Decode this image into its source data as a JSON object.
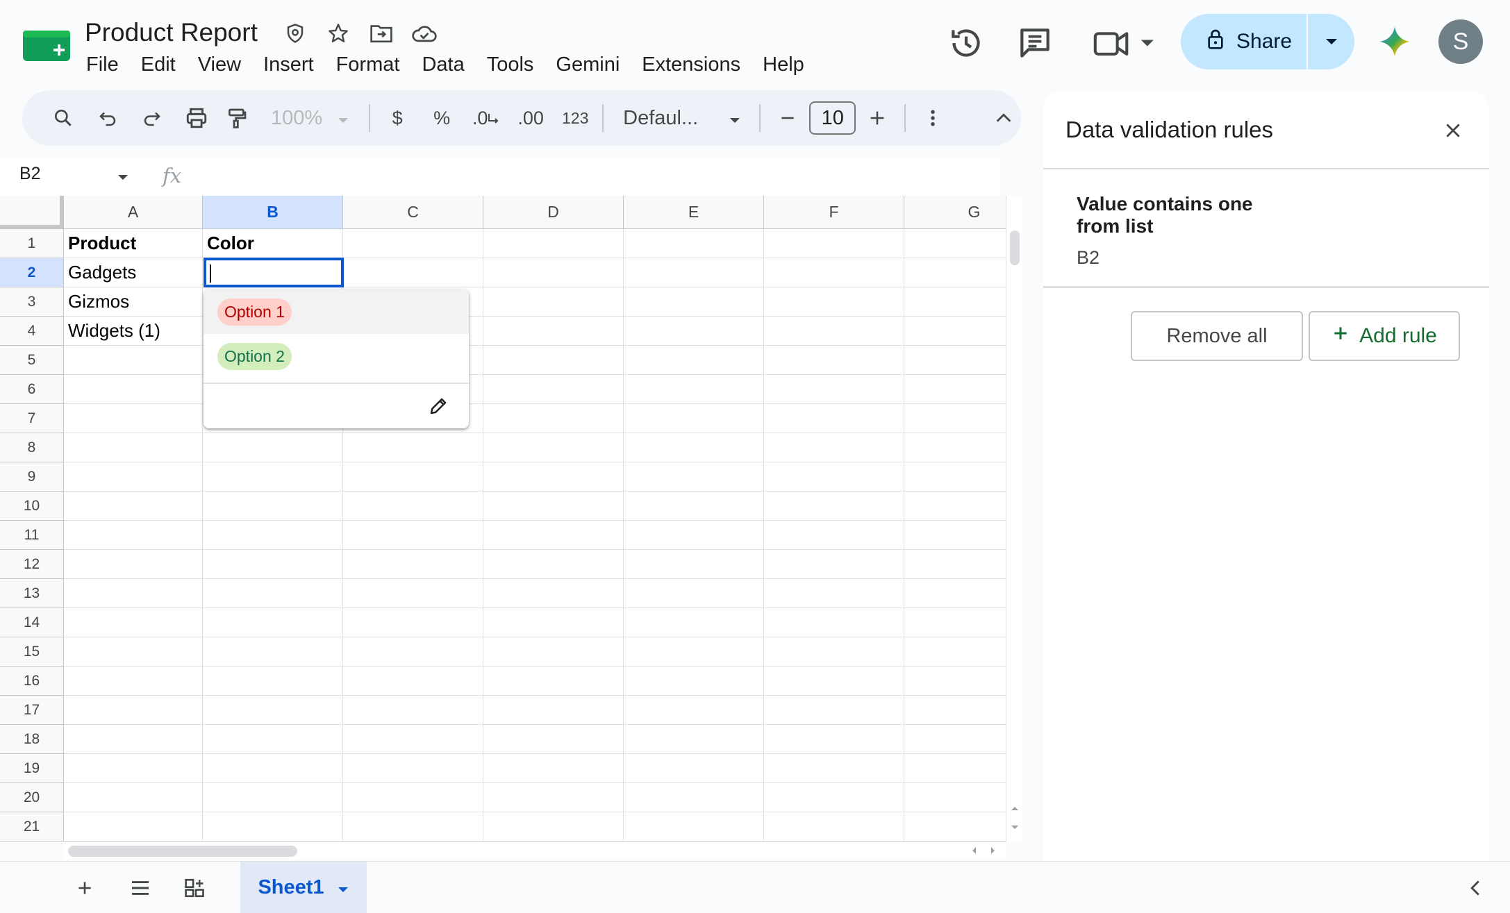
{
  "app": {
    "title": "Product Report",
    "avatar_letter": "S"
  },
  "menu": [
    "File",
    "Edit",
    "View",
    "Insert",
    "Format",
    "Data",
    "Tools",
    "Gemini",
    "Extensions",
    "Help"
  ],
  "share": {
    "label": "Share"
  },
  "toolbar": {
    "zoom": "100%",
    "currency": "$",
    "percent": "%",
    "decrease_decimal": ".0",
    "increase_decimal": ".00",
    "number_format": "123",
    "font": "Defaul...",
    "font_size": "10"
  },
  "formula_bar": {
    "name_box": "B2",
    "fx": "fx",
    "value": ""
  },
  "grid": {
    "columns": [
      "A",
      "B",
      "C",
      "D",
      "E",
      "F",
      "G"
    ],
    "selected_column": "B",
    "selected_row": 2,
    "rows": [
      "1",
      "2",
      "3",
      "4",
      "5",
      "6",
      "7",
      "8",
      "9",
      "10",
      "11",
      "12",
      "13",
      "14",
      "15",
      "16",
      "17",
      "18",
      "19",
      "20",
      "21"
    ],
    "cells": {
      "A1": "Product",
      "B1": "Color",
      "A2": "Gadgets",
      "A3": "Gizmos",
      "A4": "Widgets (1)"
    }
  },
  "dropdown": {
    "options": [
      {
        "label": "Option 1",
        "color": "#ffcfc9",
        "text_color": "#b10202"
      },
      {
        "label": "Option 2",
        "color": "#d4edbc",
        "text_color": "#11734b"
      }
    ]
  },
  "panel": {
    "title": "Data validation rules",
    "rule": {
      "condition": "Value contains one from list",
      "range": "B2"
    },
    "remove_all": "Remove all",
    "add_rule": "Add rule"
  },
  "sheets": [
    {
      "name": "Sheet1",
      "active": true
    }
  ],
  "colors": {
    "accent": "#0b57d0",
    "share_bg": "#c2e7ff",
    "add_rule_green": "#146c2e"
  }
}
